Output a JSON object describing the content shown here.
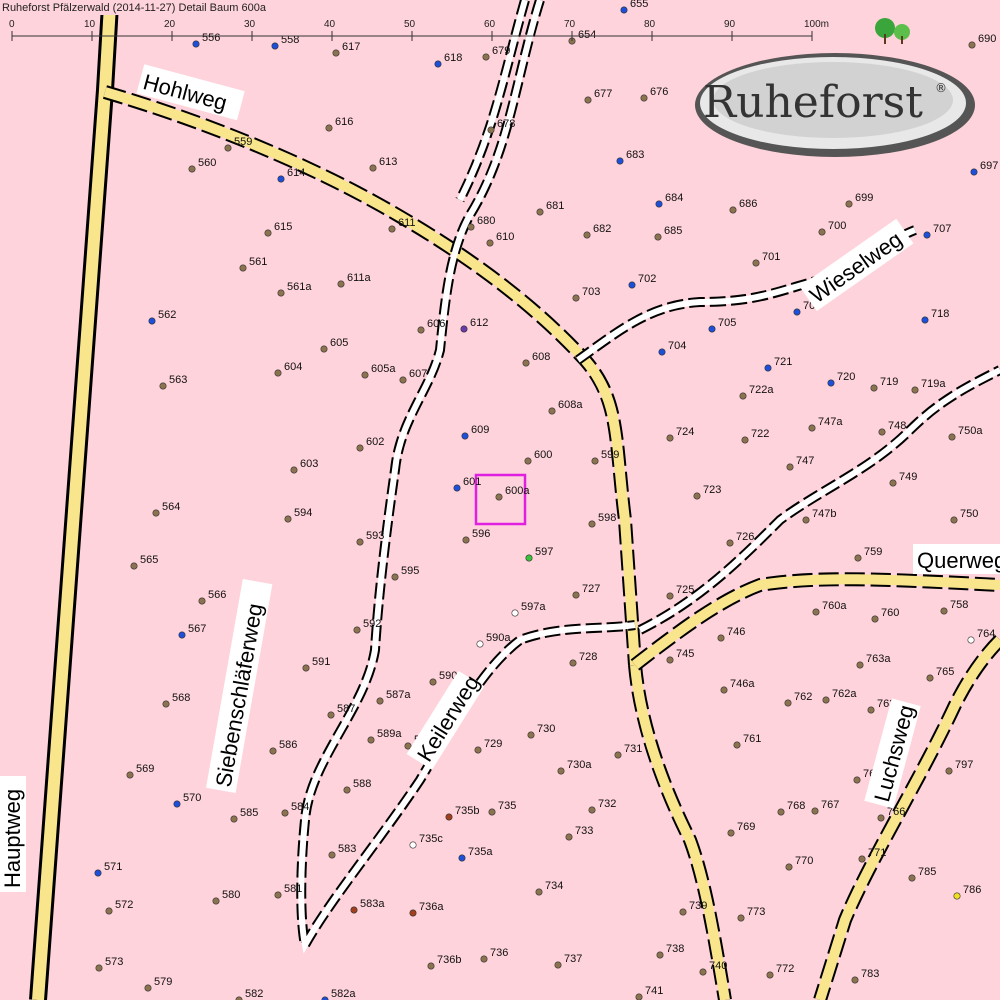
{
  "title": "Ruheforst Pfälzerwald (2014-11-27) Detail  Baum 600a",
  "logo": {
    "text": "Ruheforst",
    "mark": "®"
  },
  "scale": {
    "ticks": [
      "0",
      "10",
      "20",
      "30",
      "40",
      "50",
      "60",
      "70",
      "80",
      "90",
      "100m"
    ]
  },
  "colors": {
    "background": "#ffd3dc",
    "road": "#f8e58c",
    "highlight": "#e020e0",
    "tree_brown": "#8b7350",
    "tree_blue": "#1e4fd8",
    "tree_green": "#3ac23a",
    "tree_white": "#ffffff",
    "tree_purple": "#6a3aa8",
    "tree_darkred": "#a0401e",
    "tree_yellow": "#f0e020"
  },
  "roads": [
    {
      "name": "Hohlweg"
    },
    {
      "name": "Hauptweg"
    },
    {
      "name": "Querweg"
    },
    {
      "name": "Luchsweg"
    }
  ],
  "paths": [
    {
      "name": "Wieselweg"
    },
    {
      "name": "Siebenschläferweg"
    },
    {
      "name": "Keilerweg"
    }
  ],
  "trees": [
    {
      "id": "556",
      "c": "b"
    },
    {
      "id": "558",
      "c": "b"
    },
    {
      "id": "617",
      "c": "n"
    },
    {
      "id": "618",
      "c": "b"
    },
    {
      "id": "679",
      "c": "n"
    },
    {
      "id": "654",
      "c": "n"
    },
    {
      "id": "655",
      "c": "b"
    },
    {
      "id": "677",
      "c": "n"
    },
    {
      "id": "676",
      "c": "n"
    },
    {
      "id": "678",
      "c": "n"
    },
    {
      "id": "616",
      "c": "n"
    },
    {
      "id": "559",
      "c": "n"
    },
    {
      "id": "560",
      "c": "n"
    },
    {
      "id": "614",
      "c": "b"
    },
    {
      "id": "613",
      "c": "n"
    },
    {
      "id": "683",
      "c": "b"
    },
    {
      "id": "684",
      "c": "b"
    },
    {
      "id": "686",
      "c": "n"
    },
    {
      "id": "681",
      "c": "n"
    },
    {
      "id": "680",
      "c": "n"
    },
    {
      "id": "610",
      "c": "n"
    },
    {
      "id": "682",
      "c": "n"
    },
    {
      "id": "685",
      "c": "n"
    },
    {
      "id": "611",
      "c": "n"
    },
    {
      "id": "615",
      "c": "n"
    },
    {
      "id": "561",
      "c": "n"
    },
    {
      "id": "561a",
      "c": "n"
    },
    {
      "id": "611a",
      "c": "n"
    },
    {
      "id": "703",
      "c": "n"
    },
    {
      "id": "702",
      "c": "b"
    },
    {
      "id": "701",
      "c": "n"
    },
    {
      "id": "700",
      "c": "n"
    },
    {
      "id": "699",
      "c": "n"
    },
    {
      "id": "707",
      "c": "b"
    },
    {
      "id": "697",
      "c": "b"
    },
    {
      "id": "690",
      "c": "n"
    },
    {
      "id": "562",
      "c": "b"
    },
    {
      "id": "606",
      "c": "n"
    },
    {
      "id": "612",
      "c": "p"
    },
    {
      "id": "605",
      "c": "n"
    },
    {
      "id": "705",
      "c": "b"
    },
    {
      "id": "706",
      "c": "b"
    },
    {
      "id": "718",
      "c": "b"
    },
    {
      "id": "704",
      "c": "b"
    },
    {
      "id": "608",
      "c": "n"
    },
    {
      "id": "604",
      "c": "n"
    },
    {
      "id": "605a",
      "c": "n"
    },
    {
      "id": "607",
      "c": "n"
    },
    {
      "id": "563",
      "c": "n"
    },
    {
      "id": "721",
      "c": "b"
    },
    {
      "id": "720",
      "c": "b"
    },
    {
      "id": "719",
      "c": "n"
    },
    {
      "id": "719a",
      "c": "n"
    },
    {
      "id": "722a",
      "c": "n"
    },
    {
      "id": "608a",
      "c": "n"
    },
    {
      "id": "609",
      "c": "b"
    },
    {
      "id": "724",
      "c": "n"
    },
    {
      "id": "722",
      "c": "n"
    },
    {
      "id": "747a",
      "c": "n"
    },
    {
      "id": "748",
      "c": "n"
    },
    {
      "id": "750a",
      "c": "n"
    },
    {
      "id": "602",
      "c": "n"
    },
    {
      "id": "600",
      "c": "n"
    },
    {
      "id": "599",
      "c": "n"
    },
    {
      "id": "747",
      "c": "n"
    },
    {
      "id": "603",
      "c": "n"
    },
    {
      "id": "601",
      "c": "b"
    },
    {
      "id": "600a",
      "c": "n"
    },
    {
      "id": "723",
      "c": "n"
    },
    {
      "id": "749",
      "c": "n"
    },
    {
      "id": "564",
      "c": "n"
    },
    {
      "id": "594",
      "c": "n"
    },
    {
      "id": "598",
      "c": "n"
    },
    {
      "id": "747b",
      "c": "n"
    },
    {
      "id": "750",
      "c": "n"
    },
    {
      "id": "593",
      "c": "n"
    },
    {
      "id": "596",
      "c": "n"
    },
    {
      "id": "726",
      "c": "n"
    },
    {
      "id": "597",
      "c": "g"
    },
    {
      "id": "759",
      "c": "n"
    },
    {
      "id": "565",
      "c": "n"
    },
    {
      "id": "595",
      "c": "n"
    },
    {
      "id": "727",
      "c": "n"
    },
    {
      "id": "725",
      "c": "n"
    },
    {
      "id": "566",
      "c": "n"
    },
    {
      "id": "597a",
      "c": "w"
    },
    {
      "id": "760a",
      "c": "n"
    },
    {
      "id": "760",
      "c": "n"
    },
    {
      "id": "758",
      "c": "n"
    },
    {
      "id": "592",
      "c": "n"
    },
    {
      "id": "567",
      "c": "b"
    },
    {
      "id": "746",
      "c": "n"
    },
    {
      "id": "764",
      "c": "w"
    },
    {
      "id": "590a",
      "c": "w"
    },
    {
      "id": "728",
      "c": "n"
    },
    {
      "id": "745",
      "c": "n"
    },
    {
      "id": "763a",
      "c": "n"
    },
    {
      "id": "591",
      "c": "n"
    },
    {
      "id": "590",
      "c": "n"
    },
    {
      "id": "765",
      "c": "n"
    },
    {
      "id": "746a",
      "c": "n"
    },
    {
      "id": "587a",
      "c": "n"
    },
    {
      "id": "568",
      "c": "n"
    },
    {
      "id": "762",
      "c": "n"
    },
    {
      "id": "762a",
      "c": "n"
    },
    {
      "id": "763",
      "c": "n"
    },
    {
      "id": "587",
      "c": "n"
    },
    {
      "id": "730",
      "c": "n"
    },
    {
      "id": "589a",
      "c": "n"
    },
    {
      "id": "589",
      "c": "n"
    },
    {
      "id": "729",
      "c": "n"
    },
    {
      "id": "586",
      "c": "n"
    },
    {
      "id": "761",
      "c": "n"
    },
    {
      "id": "731",
      "c": "n"
    },
    {
      "id": "730a",
      "c": "n"
    },
    {
      "id": "797",
      "c": "n"
    },
    {
      "id": "569",
      "c": "n"
    },
    {
      "id": "588",
      "c": "n"
    },
    {
      "id": "766a",
      "c": "n"
    },
    {
      "id": "570",
      "c": "b"
    },
    {
      "id": "585",
      "c": "n"
    },
    {
      "id": "584",
      "c": "n"
    },
    {
      "id": "735b",
      "c": "r"
    },
    {
      "id": "735",
      "c": "n"
    },
    {
      "id": "732",
      "c": "n"
    },
    {
      "id": "768",
      "c": "n"
    },
    {
      "id": "767",
      "c": "n"
    },
    {
      "id": "766",
      "c": "n"
    },
    {
      "id": "733",
      "c": "n"
    },
    {
      "id": "769",
      "c": "n"
    },
    {
      "id": "735c",
      "c": "w"
    },
    {
      "id": "583",
      "c": "n"
    },
    {
      "id": "735a",
      "c": "b"
    },
    {
      "id": "771",
      "c": "n"
    },
    {
      "id": "770",
      "c": "n"
    },
    {
      "id": "571",
      "c": "b"
    },
    {
      "id": "785",
      "c": "n"
    },
    {
      "id": "734",
      "c": "n"
    },
    {
      "id": "786",
      "c": "y"
    },
    {
      "id": "580",
      "c": "n"
    },
    {
      "id": "581",
      "c": "n"
    },
    {
      "id": "572",
      "c": "n"
    },
    {
      "id": "583a",
      "c": "r"
    },
    {
      "id": "736a",
      "c": "r"
    },
    {
      "id": "739",
      "c": "n"
    },
    {
      "id": "773",
      "c": "n"
    },
    {
      "id": "738",
      "c": "n"
    },
    {
      "id": "573",
      "c": "n"
    },
    {
      "id": "736b",
      "c": "n"
    },
    {
      "id": "736",
      "c": "n"
    },
    {
      "id": "737",
      "c": "n"
    },
    {
      "id": "740",
      "c": "n"
    },
    {
      "id": "772",
      "c": "n"
    },
    {
      "id": "783",
      "c": "n"
    },
    {
      "id": "579",
      "c": "n"
    },
    {
      "id": "582",
      "c": "n"
    },
    {
      "id": "582a",
      "c": "b"
    },
    {
      "id": "741",
      "c": "n"
    }
  ]
}
